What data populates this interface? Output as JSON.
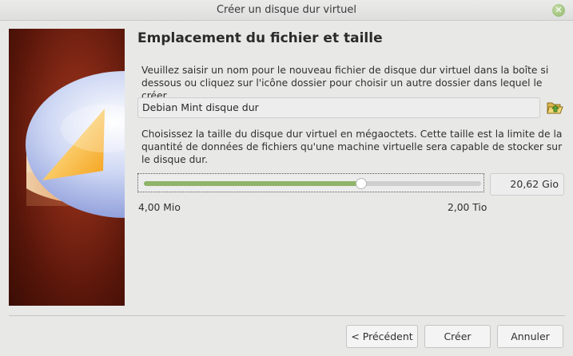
{
  "window": {
    "title": "Créer un disque dur virtuel",
    "close_glyph": "✕"
  },
  "page": {
    "heading": "Emplacement du fichier et taille",
    "location_instructions": "Veuillez saisir un nom pour le nouveau fichier de disque dur virtuel dans la boîte si dessous ou cliquez sur l'icône dossier pour choisir un autre dossier dans lequel le créer.",
    "file_name_value": "Debian Mint disque dur",
    "folder_icon": "folder-open-icon",
    "size_instructions": "Choisissez la taille du disque dur virtuel en mégaoctets. Cette taille est la limite de la quantité de données de fichiers qu'une machine virtuelle sera capable de stocker sur le disque dur.",
    "size_slider_fraction": 0.645,
    "size_value": "20,62 Gio",
    "size_min_label": "4,00 Mio",
    "size_max_label": "2,00 Tio"
  },
  "buttons": {
    "back_label": "< Précédent",
    "create_label": "Créer",
    "cancel_label": "Annuler"
  },
  "colors": {
    "accent": "#8fb46a",
    "side_panel": "#7e2614"
  }
}
